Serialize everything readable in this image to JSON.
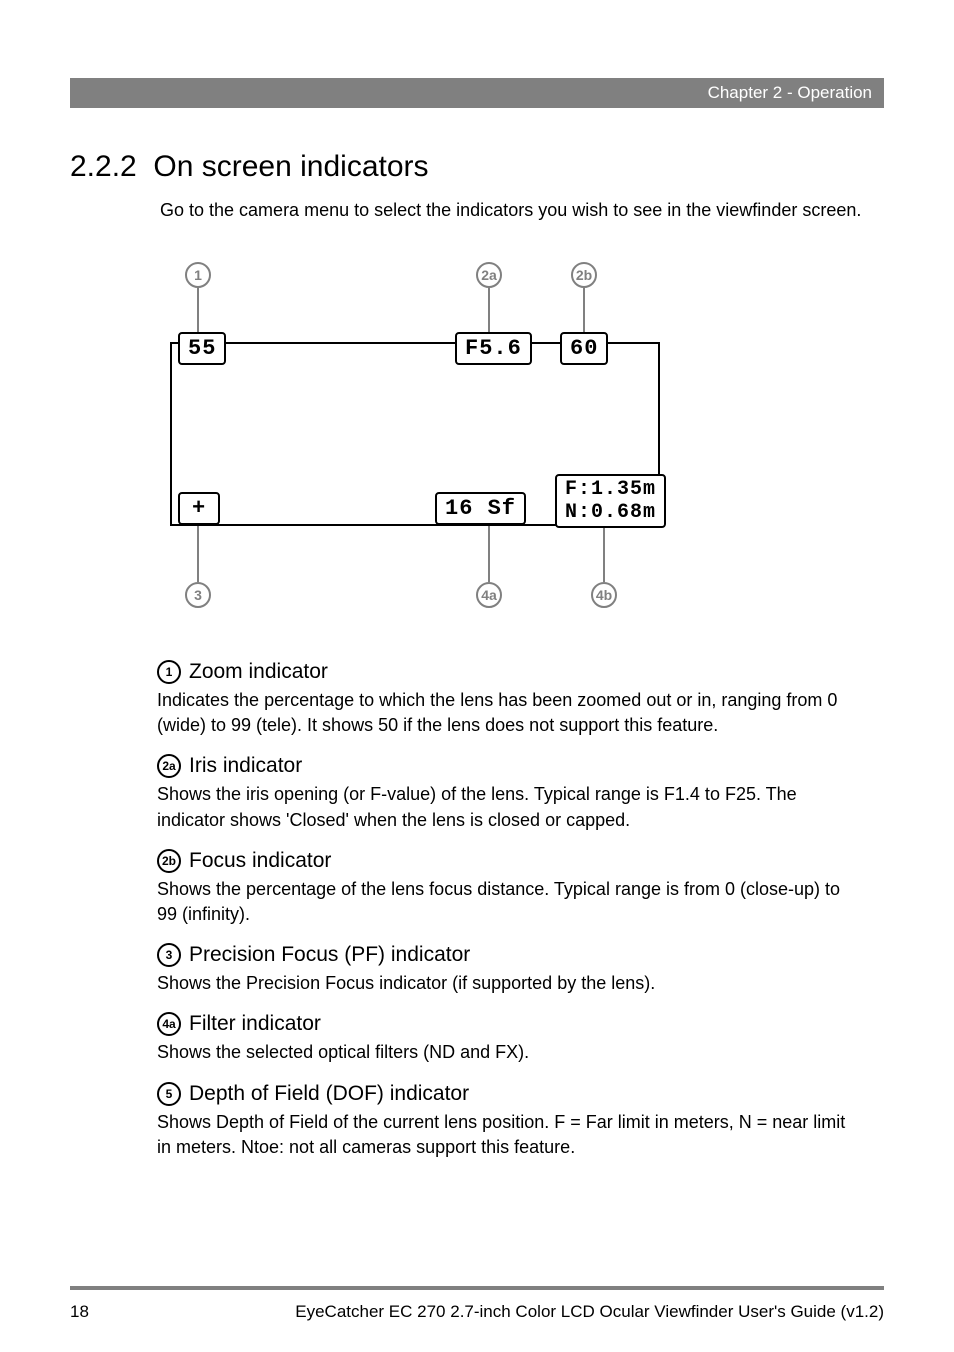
{
  "header": {
    "chapter": "Chapter 2 - Operation"
  },
  "section": {
    "number": "2.2.2",
    "title": "On screen indicators"
  },
  "intro": "Go to the camera menu to select the indicators you wish to see in the viewfinder screen.",
  "diagram": {
    "markers": {
      "m1": "1",
      "m2a": "2a",
      "m2b": "2b",
      "m3": "3",
      "m4a": "4a",
      "m4b": "4b"
    },
    "osd": {
      "zoom": "55",
      "iris": "F5.6",
      "focus": "60",
      "pf": "+",
      "filter": "16 Sf",
      "dof_far": "F:1.35m",
      "dof_near": "N:0.68m"
    }
  },
  "descriptions": [
    {
      "badge": "1",
      "title": "Zoom indicator",
      "body": "Indicates the percentage to which the lens has been zoomed out or in, ranging from 0 (wide) to 99 (tele). It shows 50 if the lens does not support this feature."
    },
    {
      "badge": "2a",
      "title": "Iris indicator",
      "body": "Shows the iris opening (or F-value) of the lens. Typical range is F1.4 to F25. The indicator shows 'Closed' when the lens is closed or capped."
    },
    {
      "badge": "2b",
      "title": "Focus indicator",
      "body": "Shows the percentage of the lens focus distance. Typical range is from 0 (close-up) to 99 (infinity)."
    },
    {
      "badge": "3",
      "title": "Precision Focus (PF) indicator",
      "body": "Shows the Precision Focus indicator (if supported by the lens)."
    },
    {
      "badge": "4a",
      "title": "Filter indicator",
      "body": "Shows the selected optical filters (ND and FX)."
    },
    {
      "badge": "5",
      "title": "Depth of Field (DOF) indicator",
      "body": "Shows Depth of Field of the current lens position. F = Far limit in meters, N = near limit in meters. Ntoe: not all cameras support this feature."
    }
  ],
  "footer": {
    "page": "18",
    "doc": "EyeCatcher EC 270 2.7-inch Color LCD Ocular Viewfinder User's Guide (v1.2)"
  }
}
